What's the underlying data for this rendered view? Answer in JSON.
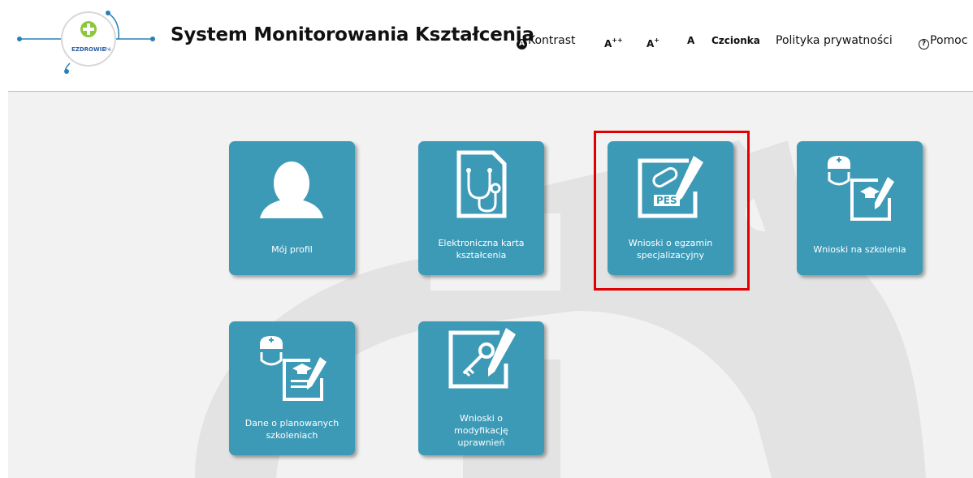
{
  "logo": {
    "text": "EZDROWIE",
    "suffix": "P4"
  },
  "header": {
    "title": "System Monitorowania Kształcenia"
  },
  "toolbar": {
    "contrast_icon": "A",
    "contrast": "Kontrast",
    "font_large_base": "A",
    "font_large_mark": "++",
    "font_medium_base": "A",
    "font_medium_mark": "+",
    "font_normal": "A",
    "font_label": "Czcionka",
    "privacy": "Polityka prywatności",
    "help_icon": "?",
    "help": "Pomoc"
  },
  "tiles": {
    "profile": "Mój profil",
    "ekk_line1": "Elektroniczna karta",
    "ekk_line2": "kształcenia",
    "pes_line1": "Wnioski o egzamin",
    "pes_line2": "specjalizacyjny",
    "pes_badge": "PES",
    "training": "Wnioski na szkolenia",
    "planned_line1": "Dane o planowanych",
    "planned_line2": "szkoleniach",
    "modify_line1": "Wnioski o",
    "modify_line2": "modyfikację",
    "modify_line3": "uprawnień"
  },
  "colors": {
    "tile": "#3d9ab7",
    "highlight": "#e00000",
    "logo_green": "#8dc63f",
    "logo_blue": "#2a7fb5"
  }
}
